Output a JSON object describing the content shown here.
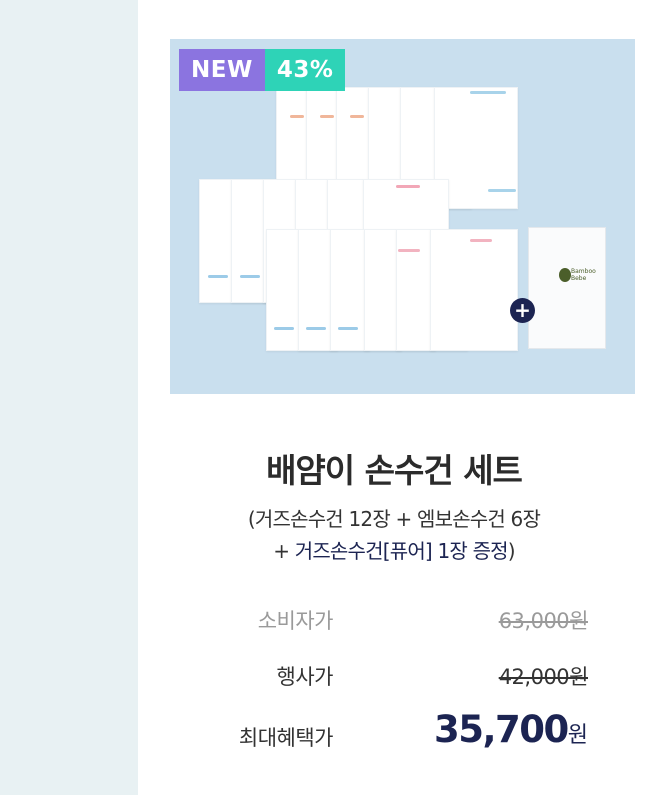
{
  "product": {
    "badges": {
      "new": "NEW",
      "discount": "43%"
    },
    "title": "배얌이 손수건 세트",
    "subtitle_line1": "(거즈손수건 12장 + 엠보손수건 6장",
    "subtitle_line2_prefix": "+ ",
    "subtitle_line2_highlight": "거즈손수건[퓨어] 1장 증정",
    "subtitle_line2_suffix": ")",
    "plus_sign": "+",
    "logo_text": "Bamboo Bebe"
  },
  "prices": {
    "consumer_label": "소비자가",
    "consumer_value": "63,000원",
    "event_label": "행사가",
    "event_value": "42,000원",
    "max_benefit_label": "최대혜택가",
    "max_benefit_value": "35,700",
    "max_benefit_unit": "원"
  },
  "colors": {
    "accent_navy": "#1c2452",
    "badge_new": "#8b74e0",
    "badge_discount": "#2ed3b7",
    "image_bg": "#c9dfee",
    "side_panel": "#e8f1f3"
  }
}
